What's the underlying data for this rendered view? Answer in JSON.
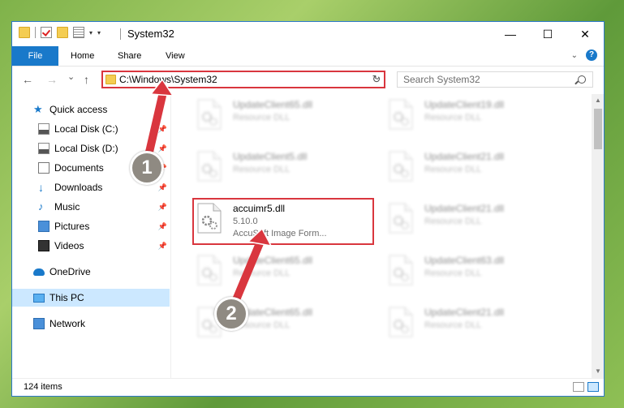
{
  "window": {
    "title": "System32",
    "controls": {
      "minimize": "—",
      "maximize": "☐",
      "close": "✕"
    }
  },
  "ribbon": {
    "tabs": [
      "File",
      "Home",
      "Share",
      "View"
    ],
    "help": "?"
  },
  "navigation": {
    "back": "←",
    "forward": "→",
    "recent": "⌄",
    "up": "↑",
    "address": "C:\\Windows\\System32",
    "refresh": "↻",
    "search_placeholder": "Search System32"
  },
  "sidebar": {
    "items": [
      {
        "label": "Quick access",
        "icon": "star-icon"
      },
      {
        "label": "Local Disk (C:)",
        "icon": "disk-icon",
        "pinned": true
      },
      {
        "label": "Local Disk (D:)",
        "icon": "disk-icon",
        "pinned": true
      },
      {
        "label": "Documents",
        "icon": "document-icon",
        "pinned": true
      },
      {
        "label": "Downloads",
        "icon": "download-icon",
        "pinned": true
      },
      {
        "label": "Music",
        "icon": "music-icon",
        "pinned": true
      },
      {
        "label": "Pictures",
        "icon": "pictures-icon",
        "pinned": true
      },
      {
        "label": "Videos",
        "icon": "videos-icon",
        "pinned": true
      },
      {
        "label": "OneDrive",
        "icon": "cloud-icon"
      },
      {
        "label": "This PC",
        "icon": "computer-icon",
        "selected": true
      },
      {
        "label": "Network",
        "icon": "network-icon"
      }
    ]
  },
  "files": [
    {
      "name": "UpdateClient65.dll",
      "desc": "Resource DLL"
    },
    {
      "name": "UpdateClient19.dll",
      "desc": "Resource DLL"
    },
    {
      "name": "UpdateClient5.dll",
      "desc": "Resource DLL"
    },
    {
      "name": "UpdateClient21.dll",
      "desc": "Resource DLL"
    },
    {
      "name": "accuimr5.dll",
      "version": "5.10.0",
      "desc": "AccuSoft Image Form..."
    },
    {
      "name": "UpdateClient21.dll",
      "desc": "Resource DLL"
    },
    {
      "name": "UpdateClient65.dll",
      "desc": "Resource DLL"
    },
    {
      "name": "UpdateClient63.dll",
      "desc": "Resource DLL"
    },
    {
      "name": "UpdateClient65.dll",
      "desc": "Resource DLL"
    },
    {
      "name": "UpdateClient21.dll",
      "desc": "Resource DLL"
    }
  ],
  "status": {
    "count": "124 items"
  },
  "markers": [
    "1",
    "2"
  ],
  "colors": {
    "accent": "#1979ca",
    "highlight": "#d9363e",
    "marker": "#8f8a82"
  }
}
